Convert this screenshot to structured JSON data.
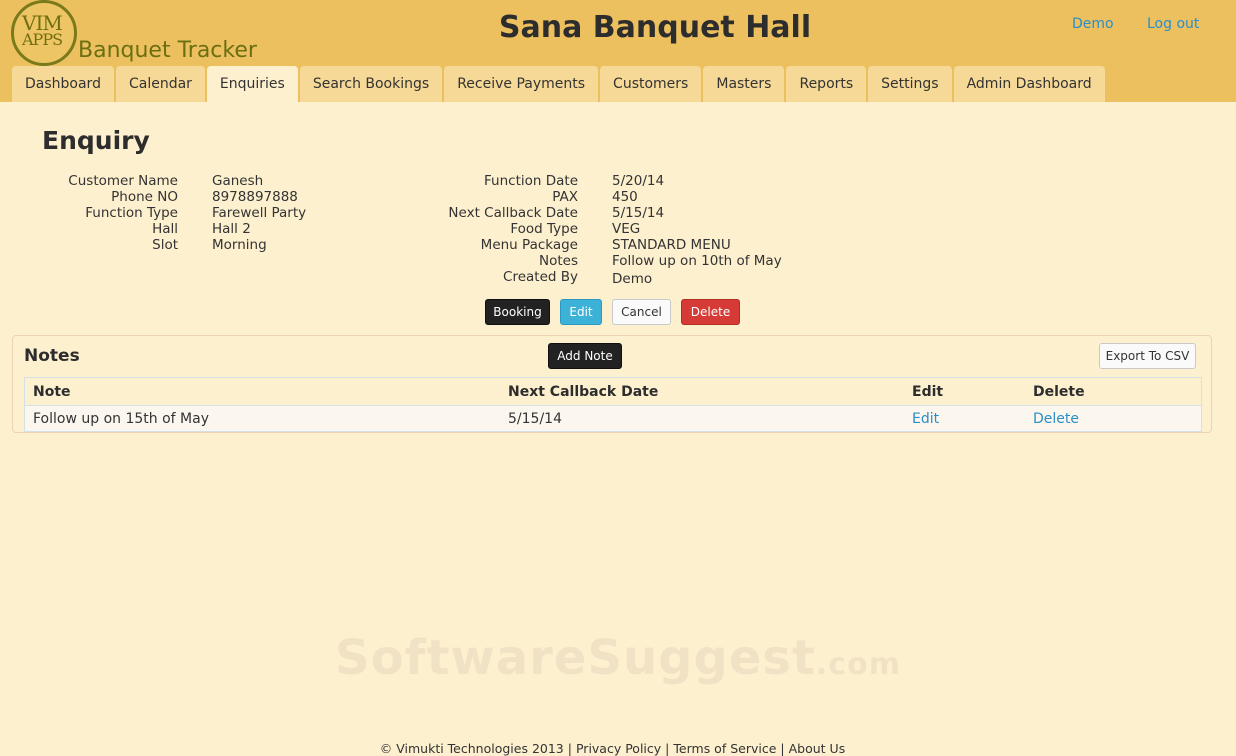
{
  "header": {
    "logo_line1": "VIM",
    "logo_line2": "APPS",
    "app_name": "Banquet Tracker",
    "hall_name": "Sana Banquet Hall",
    "user_link": "Demo",
    "logout_link": "Log out"
  },
  "tabs": [
    {
      "label": "Dashboard"
    },
    {
      "label": "Calendar"
    },
    {
      "label": "Enquiries",
      "active": true
    },
    {
      "label": "Search Bookings"
    },
    {
      "label": "Receive Payments"
    },
    {
      "label": "Customers"
    },
    {
      "label": "Masters"
    },
    {
      "label": "Reports"
    },
    {
      "label": "Settings"
    },
    {
      "label": "Admin Dashboard"
    }
  ],
  "enquiry": {
    "title": "Enquiry",
    "left": [
      {
        "label": "Customer Name",
        "value": "Ganesh"
      },
      {
        "label": "Phone NO",
        "value": "8978897888"
      },
      {
        "label": "Function Type",
        "value": "Farewell Party"
      },
      {
        "label": "Hall",
        "value": "Hall 2"
      },
      {
        "label": "Slot",
        "value": "Morning"
      }
    ],
    "right": [
      {
        "label": "Function Date",
        "value": "5/20/14"
      },
      {
        "label": "PAX",
        "value": "450"
      },
      {
        "label": "Next Callback Date",
        "value": "5/15/14"
      },
      {
        "label": "Food Type",
        "value": "VEG"
      },
      {
        "label": "Menu Package",
        "value": "STANDARD MENU"
      },
      {
        "label": "Notes",
        "value": "Follow up on 10th of May"
      },
      {
        "label": "Created By",
        "value": "Demo"
      }
    ],
    "buttons": {
      "booking": "Booking",
      "edit": "Edit",
      "cancel": "Cancel",
      "delete": "Delete"
    }
  },
  "notes": {
    "title": "Notes",
    "add_note_label": "Add Note",
    "export_label": "Export To CSV",
    "columns": [
      "Note",
      "Next Callback Date",
      "Edit",
      "Delete"
    ],
    "rows": [
      {
        "note": "Follow up on 15th of May",
        "date": "5/15/14",
        "edit": "Edit",
        "delete": "Delete"
      }
    ]
  },
  "watermark": {
    "main": "SoftwareSuggest",
    "suffix": ".com"
  },
  "footer": {
    "copyright": "© Vimukti Technologies 2013",
    "privacy": "Privacy Policy",
    "terms": "Terms of Service",
    "about": "About Us"
  },
  "colors": {
    "header_bg": "#ecc05e",
    "page_bg": "#fdf0cf",
    "link": "#2a8ec9",
    "delete_btn": "#d63a36",
    "edit_btn": "#3db2d8"
  }
}
